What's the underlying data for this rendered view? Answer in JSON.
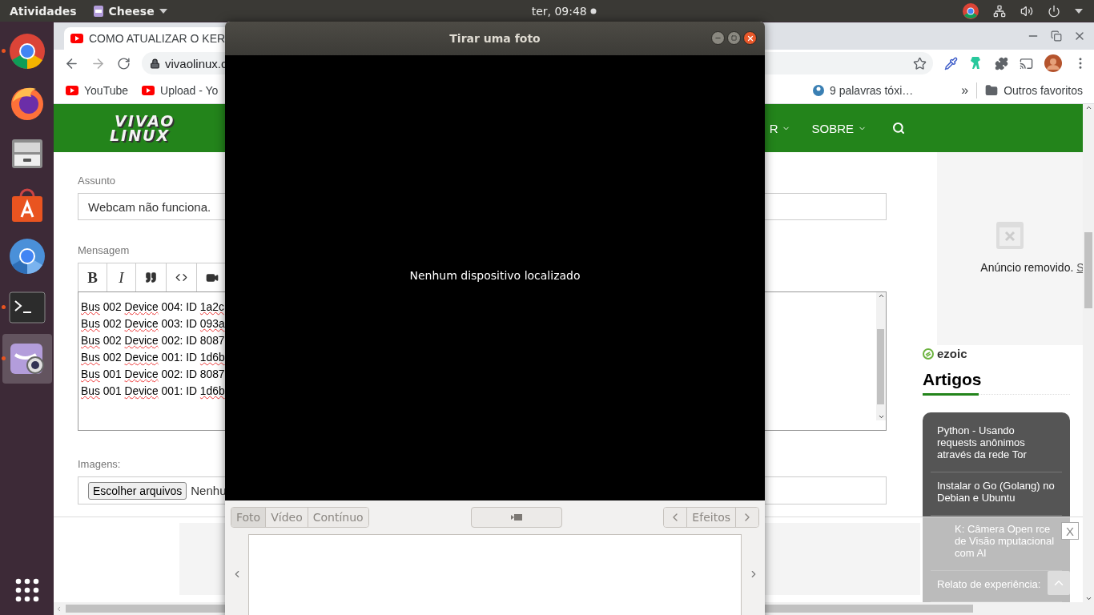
{
  "top_bar": {
    "activities": "Atividades",
    "app_menu": "Cheese",
    "clock": "ter, 09:48"
  },
  "dock": {
    "apps": [
      {
        "kind": "chrome",
        "running": true,
        "selected": false
      },
      {
        "kind": "firefox",
        "running": false,
        "selected": false
      },
      {
        "kind": "files",
        "running": false,
        "selected": false
      },
      {
        "kind": "store",
        "running": false,
        "selected": false
      },
      {
        "kind": "chromium",
        "running": false,
        "selected": false
      },
      {
        "kind": "terminal",
        "running": true,
        "selected": false
      },
      {
        "kind": "cheese",
        "running": true,
        "selected": true
      }
    ]
  },
  "browser": {
    "tab_title": "COMO ATUALIZAR O KER",
    "url": "vivaolinux.c",
    "bookmarks": [
      {
        "label": "YouTube",
        "kind": "youtube"
      },
      {
        "label": "Upload - Yo",
        "kind": "youtube"
      }
    ],
    "bookmarks_right": [
      {
        "label": "9 palavras tóxi…",
        "kind": "site"
      }
    ],
    "overflow": "»",
    "other_bookmarks": "Outros favoritos"
  },
  "site": {
    "logo": [
      "VIVAO",
      "LINUX"
    ],
    "nav": [
      "R",
      "SOBRE"
    ],
    "form": {
      "subject_label": "Assunto",
      "subject_value": "Webcam não funciona.",
      "message_label": "Mensagem",
      "editor_tools": [
        {
          "kind": "bold",
          "label": "B"
        },
        {
          "kind": "italic",
          "label": "I"
        },
        {
          "kind": "quote"
        },
        {
          "kind": "code"
        },
        {
          "kind": "video"
        }
      ],
      "message_lines": [
        [
          {
            "text": "Bus",
            "flagged": true
          },
          {
            "text": "002",
            "flagged": false
          },
          {
            "text": "Device",
            "flagged": true
          },
          {
            "text": "004: ID",
            "flagged": false
          },
          {
            "text": "1a2c",
            "flagged": true
          }
        ],
        [
          {
            "text": "Bus",
            "flagged": true
          },
          {
            "text": "002",
            "flagged": false
          },
          {
            "text": "Device",
            "flagged": true
          },
          {
            "text": "003: ID",
            "flagged": false
          },
          {
            "text": "093a",
            "flagged": true
          }
        ],
        [
          {
            "text": "Bus",
            "flagged": true
          },
          {
            "text": "002",
            "flagged": false
          },
          {
            "text": "Device",
            "flagged": true
          },
          {
            "text": "002: ID 8087",
            "flagged": false
          }
        ],
        [
          {
            "text": "Bus",
            "flagged": true
          },
          {
            "text": "002",
            "flagged": false
          },
          {
            "text": "Device",
            "flagged": true
          },
          {
            "text": "001: ID",
            "flagged": false
          },
          {
            "text": "1d6b",
            "flagged": true
          }
        ],
        [
          {
            "text": "Bus",
            "flagged": true
          },
          {
            "text": "001",
            "flagged": false
          },
          {
            "text": "Device",
            "flagged": true
          },
          {
            "text": "002: ID 8087",
            "flagged": false
          }
        ],
        [
          {
            "text": "Bus",
            "flagged": true
          },
          {
            "text": "001",
            "flagged": false
          },
          {
            "text": "Device",
            "flagged": true
          },
          {
            "text": "001: ID",
            "flagged": false
          },
          {
            "text": "1d6b",
            "flagged": true
          }
        ]
      ],
      "images_label": "Imagens:",
      "file_button": "Escolher arquivos",
      "file_status": "Nenhu"
    },
    "sidebar": {
      "ad_notice": "Anúncio removido.",
      "ad_link": "S",
      "ad_brand": "ezoic",
      "articles_title": "Artigos",
      "articles": [
        "Python - Usando requests anônimos através da rede Tor",
        "Instalar o Go (Golang) no Debian e Ubuntu",
        "K: Câmera Open rce de Visão mputacional com AI",
        "Relato de experiência:"
      ]
    },
    "ad_close": "X"
  },
  "dialog": {
    "title": "Tirar uma foto",
    "message": "Nenhum dispositivo localizado",
    "modes": [
      {
        "label": "Foto",
        "selected": true
      },
      {
        "label": "Vídeo",
        "selected": false
      },
      {
        "label": "Contínuo",
        "selected": false
      }
    ],
    "effects": "Efeitos"
  }
}
